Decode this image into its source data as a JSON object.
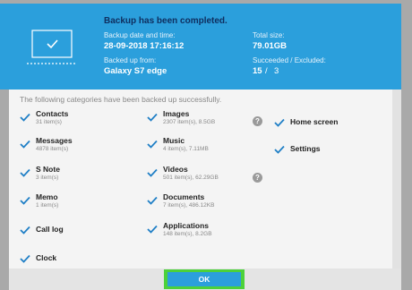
{
  "header": {
    "title": "Backup has been completed.",
    "date_label": "Backup date and time:",
    "date_value": "28-09-2018 17:16:12",
    "from_label": "Backed up from:",
    "from_value": "Galaxy S7 edge",
    "size_label": "Total size:",
    "size_value": "79.01GB",
    "succeeded_label": "Succeeded / Excluded:",
    "succeeded_value": "15",
    "excluded_value": "3",
    "separator": "/"
  },
  "intro": "The following categories have been backed up successfully.",
  "categories": [
    {
      "name": "Contacts",
      "count": "31 item(s)"
    },
    {
      "name": "Messages",
      "count": "4878 item(s)"
    },
    {
      "name": "S Note",
      "count": "3 item(s)"
    },
    {
      "name": "Memo",
      "count": "1 item(s)"
    },
    {
      "name": "Call log",
      "count": ""
    },
    {
      "name": "Clock",
      "count": ""
    },
    {
      "name": "Images",
      "count": "2307 item(s), 8.5GB"
    },
    {
      "name": "Music",
      "count": "4 item(s), 7.11MB"
    },
    {
      "name": "Videos",
      "count": "501 item(s), 62.29GB"
    },
    {
      "name": "Documents",
      "count": "7 item(s), 486.12KB"
    },
    {
      "name": "Applications",
      "count": "148 item(s), 8.2GB"
    },
    {
      "name": "Home screen",
      "count": ""
    },
    {
      "name": "Settings",
      "count": ""
    }
  ],
  "help_glyph": "?",
  "ok_label": "OK",
  "colors": {
    "header_bg": "#2b9fdc",
    "check": "#1f7fc6",
    "ok_highlight": "#4cd13a"
  }
}
